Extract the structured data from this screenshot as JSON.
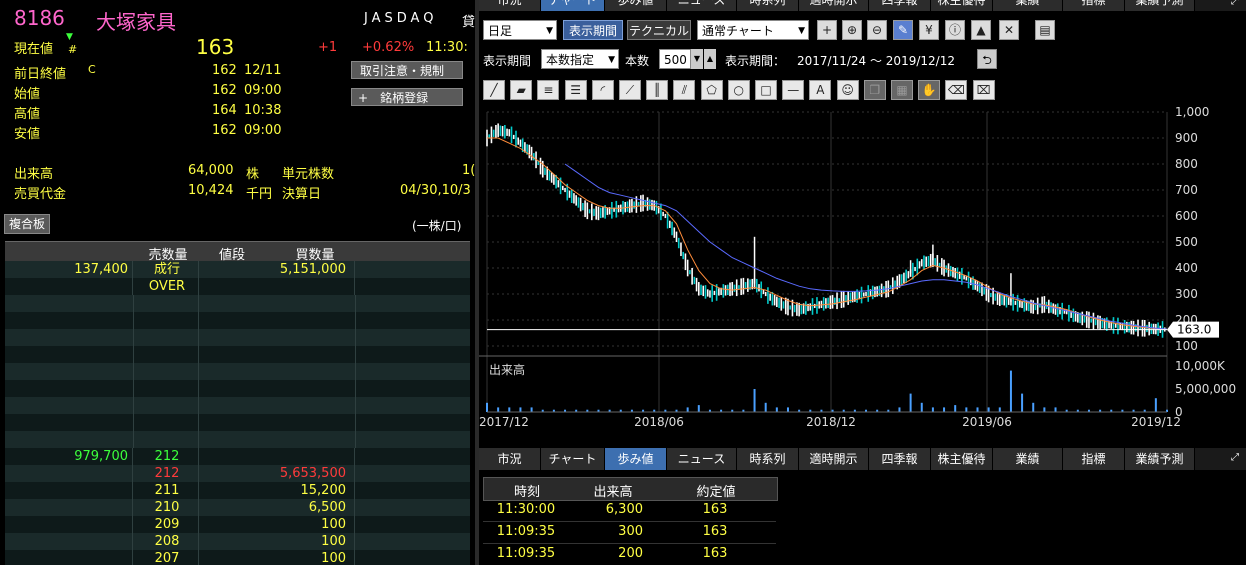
{
  "stock": {
    "code": "8186",
    "name": "大塚家具",
    "market": "JASDAQ",
    "market_suffix": "貸"
  },
  "quote": {
    "current_label": "現在値",
    "current_value": "163",
    "change": "+1",
    "change_pct": "+0.62%",
    "current_time": "11:30:",
    "prev_close_label": "前日終値",
    "prev_close_flag": "C",
    "prev_close_value": "162",
    "prev_close_date": "12/11",
    "open_label": "始値",
    "open_value": "162",
    "open_time": "09:00",
    "high_label": "高値",
    "high_value": "164",
    "high_time": "10:38",
    "low_label": "安値",
    "low_value": "162",
    "low_time": "09:00",
    "volume_label": "出来高",
    "volume_value": "64,000",
    "volume_unit": "株",
    "unit_label": "単元株数",
    "unit_value": "1(",
    "turnover_label": "売買代金",
    "turnover_value": "10,424",
    "turnover_unit": "千円",
    "settle_label": "決算日",
    "settle_value": "04/30,10/3"
  },
  "buttons": {
    "caution": "取引注意・規制",
    "register": "銘柄登録",
    "register_icon": "+"
  },
  "book": {
    "title": "複合板",
    "unit": "(一株/口)",
    "headers": [
      "売数量",
      "値段",
      "買数量"
    ],
    "top_rows": [
      {
        "sell": "137,400",
        "price": "成行",
        "buy": "5,151,000"
      },
      {
        "sell": "",
        "price": "OVER",
        "buy": ""
      }
    ],
    "bottom_rows": [
      {
        "sell": "979,700",
        "price": "212",
        "buy": ""
      },
      {
        "sell": "",
        "price": "212",
        "buy": "5,653,500"
      },
      {
        "sell": "",
        "price": "211",
        "buy": "15,200"
      },
      {
        "sell": "",
        "price": "210",
        "buy": "6,500"
      },
      {
        "sell": "",
        "price": "209",
        "buy": "100"
      },
      {
        "sell": "",
        "price": "208",
        "buy": "100"
      },
      {
        "sell": "",
        "price": "207",
        "buy": "100"
      }
    ]
  },
  "top_tabs": [
    "市況",
    "チャート",
    "歩み値",
    "ニュース",
    "時系列",
    "適時開示",
    "四季報",
    "株主優待",
    "業績",
    "指標",
    "業績予測"
  ],
  "top_active": "チャート",
  "toolbar": {
    "period_select": "日足",
    "btn_period": "表示期間",
    "btn_technical": "テクニカル",
    "chart_type": "通常チャート",
    "range_label": "表示期間",
    "range_select": "本数指定",
    "count_label": "本数",
    "count_value": "500",
    "range_text_label": "表示期間：",
    "range_text": "2017/11/24 〜 2019/12/12"
  },
  "bottom_tabs": [
    "市況",
    "チャート",
    "歩み値",
    "ニュース",
    "時系列",
    "適時開示",
    "四季報",
    "株主優待",
    "業績",
    "指標",
    "業績予測"
  ],
  "bottom_active": "歩み値",
  "ticks": {
    "headers": [
      "時刻",
      "出来高",
      "約定値"
    ],
    "rows": [
      {
        "time": "11:30:00",
        "volume": "6,300",
        "price": "163"
      },
      {
        "time": "11:09:35",
        "volume": "300",
        "price": "163"
      },
      {
        "time": "11:09:35",
        "volume": "200",
        "price": "163"
      }
    ]
  },
  "chart_data": {
    "type": "line",
    "price_axis": {
      "ticks": [
        "1,000",
        "900",
        "800",
        "700",
        "600",
        "500",
        "400",
        "300",
        "200",
        "100"
      ],
      "ylim": [
        100,
        1000
      ]
    },
    "volume_axis": {
      "label": "出来高",
      "ticks": [
        "10,000K",
        "5,000,000",
        "0"
      ],
      "ylim": [
        0,
        10000000
      ]
    },
    "x_ticks": [
      "2017/12",
      "2018/06",
      "2018/12",
      "2019/06",
      "2019/12"
    ],
    "last_price_label": "163.0",
    "last_price": 163,
    "series": [
      {
        "values": [
          900,
          930,
          920,
          880,
          840,
          780,
          740,
          700,
          660,
          620,
          610,
          620,
          630,
          640,
          650,
          640,
          600,
          520,
          400,
          320,
          300,
          310,
          320,
          330,
          340,
          300,
          270,
          250,
          240,
          250,
          260,
          270,
          280,
          290,
          300,
          310,
          320,
          350,
          380,
          420,
          430,
          400,
          380,
          360,
          330,
          300,
          280,
          270,
          260,
          250,
          260,
          240,
          230,
          210,
          200,
          190,
          180,
          175,
          170,
          168,
          165,
          163
        ]
      },
      {
        "values": [
          900,
          900,
          880,
          860,
          830,
          800,
          760,
          720,
          690,
          660,
          640,
          630,
          630,
          635,
          640,
          640,
          620,
          570,
          470,
          390,
          340,
          320,
          315,
          320,
          325,
          315,
          295,
          275,
          260,
          255,
          258,
          262,
          270,
          278,
          288,
          298,
          308,
          330,
          355,
          390,
          410,
          400,
          385,
          370,
          350,
          325,
          300,
          285,
          272,
          262,
          258,
          250,
          240,
          225,
          212,
          200,
          190,
          182,
          176,
          171,
          167,
          165
        ]
      },
      {
        "values": [
          null,
          null,
          null,
          null,
          null,
          null,
          null,
          800,
          770,
          740,
          710,
          690,
          680,
          670,
          660,
          650,
          640,
          620,
          580,
          540,
          500,
          470,
          440,
          420,
          400,
          380,
          360,
          345,
          330,
          320,
          315,
          312,
          310,
          310,
          312,
          315,
          320,
          330,
          340,
          350,
          355,
          355,
          350,
          345,
          335,
          320,
          305,
          290,
          278,
          265,
          255,
          245,
          235,
          225,
          215,
          205,
          195,
          188,
          180,
          174,
          168,
          165
        ]
      }
    ],
    "volume_values": [
      2,
      1,
      1,
      1,
      1,
      0.5,
      0.5,
      0.5,
      0.5,
      0.5,
      0.5,
      0.5,
      0.5,
      0.5,
      0.5,
      0.5,
      0.5,
      0.5,
      1,
      1.5,
      0.5,
      0.5,
      0.5,
      0.5,
      5,
      2,
      1,
      1,
      0.5,
      0.5,
      0.5,
      0.5,
      0.5,
      0.5,
      0.5,
      0.5,
      0.5,
      1,
      4,
      2,
      1,
      1,
      1.5,
      1,
      1,
      1,
      1,
      9,
      4,
      2,
      1,
      1,
      0.5,
      0.5,
      0.5,
      0.5,
      0.5,
      0.5,
      0.5,
      0.5,
      3,
      0.5
    ],
    "colors": {
      "candle_up": "#ffffff",
      "candle_down": "#00cccc",
      "ma_short": "#ff8c3a",
      "ma_long": "#5a6aff",
      "volume": "#4aa0ff",
      "grid": "#333333"
    }
  }
}
